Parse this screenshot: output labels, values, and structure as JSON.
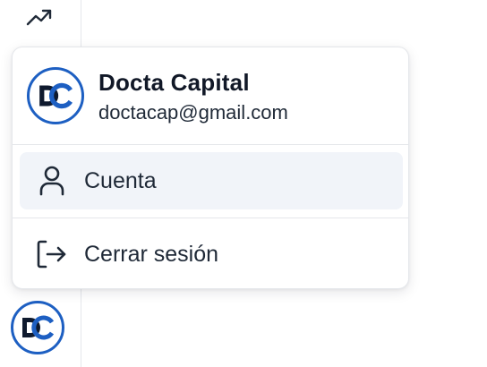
{
  "sidebar": {
    "top_icon": "trending-up-icon",
    "avatar_icon": "docta-logo"
  },
  "menu": {
    "profile": {
      "name": "Docta Capital",
      "email": "doctacap@gmail.com",
      "logo_icon": "docta-logo"
    },
    "items": [
      {
        "label": "Cuenta",
        "icon": "user-icon",
        "active": true
      },
      {
        "label": "Cerrar sesión",
        "icon": "logout-icon",
        "active": false
      }
    ]
  },
  "colors": {
    "brand_blue": "#1d5fc2",
    "logo_dark": "#0f1a2e",
    "active_bg": "#f1f4f9",
    "border": "#e5e7eb"
  }
}
